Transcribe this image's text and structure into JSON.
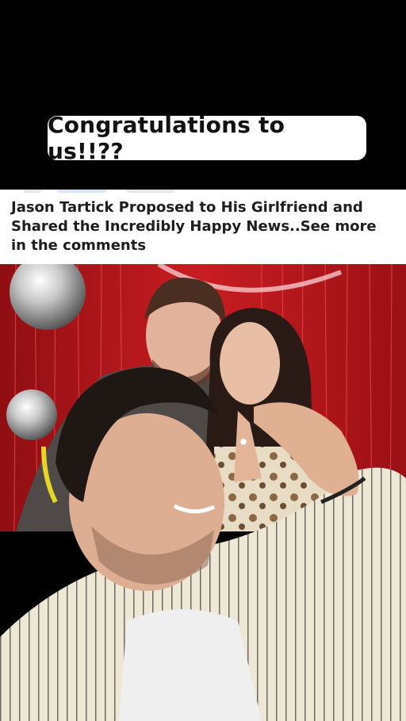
{
  "overlay": {
    "caption": "Congratulations to us!!??"
  },
  "post": {
    "headline": "Jason Tartick Proposed to His Girlfriend and Shared the Incredibly Happy News..See more in the comments"
  },
  "colors": {
    "background": "#000000",
    "caption_bg": "#ffffff",
    "headline_text": "#1c1e21",
    "tinsel_red": "#b3161b"
  }
}
